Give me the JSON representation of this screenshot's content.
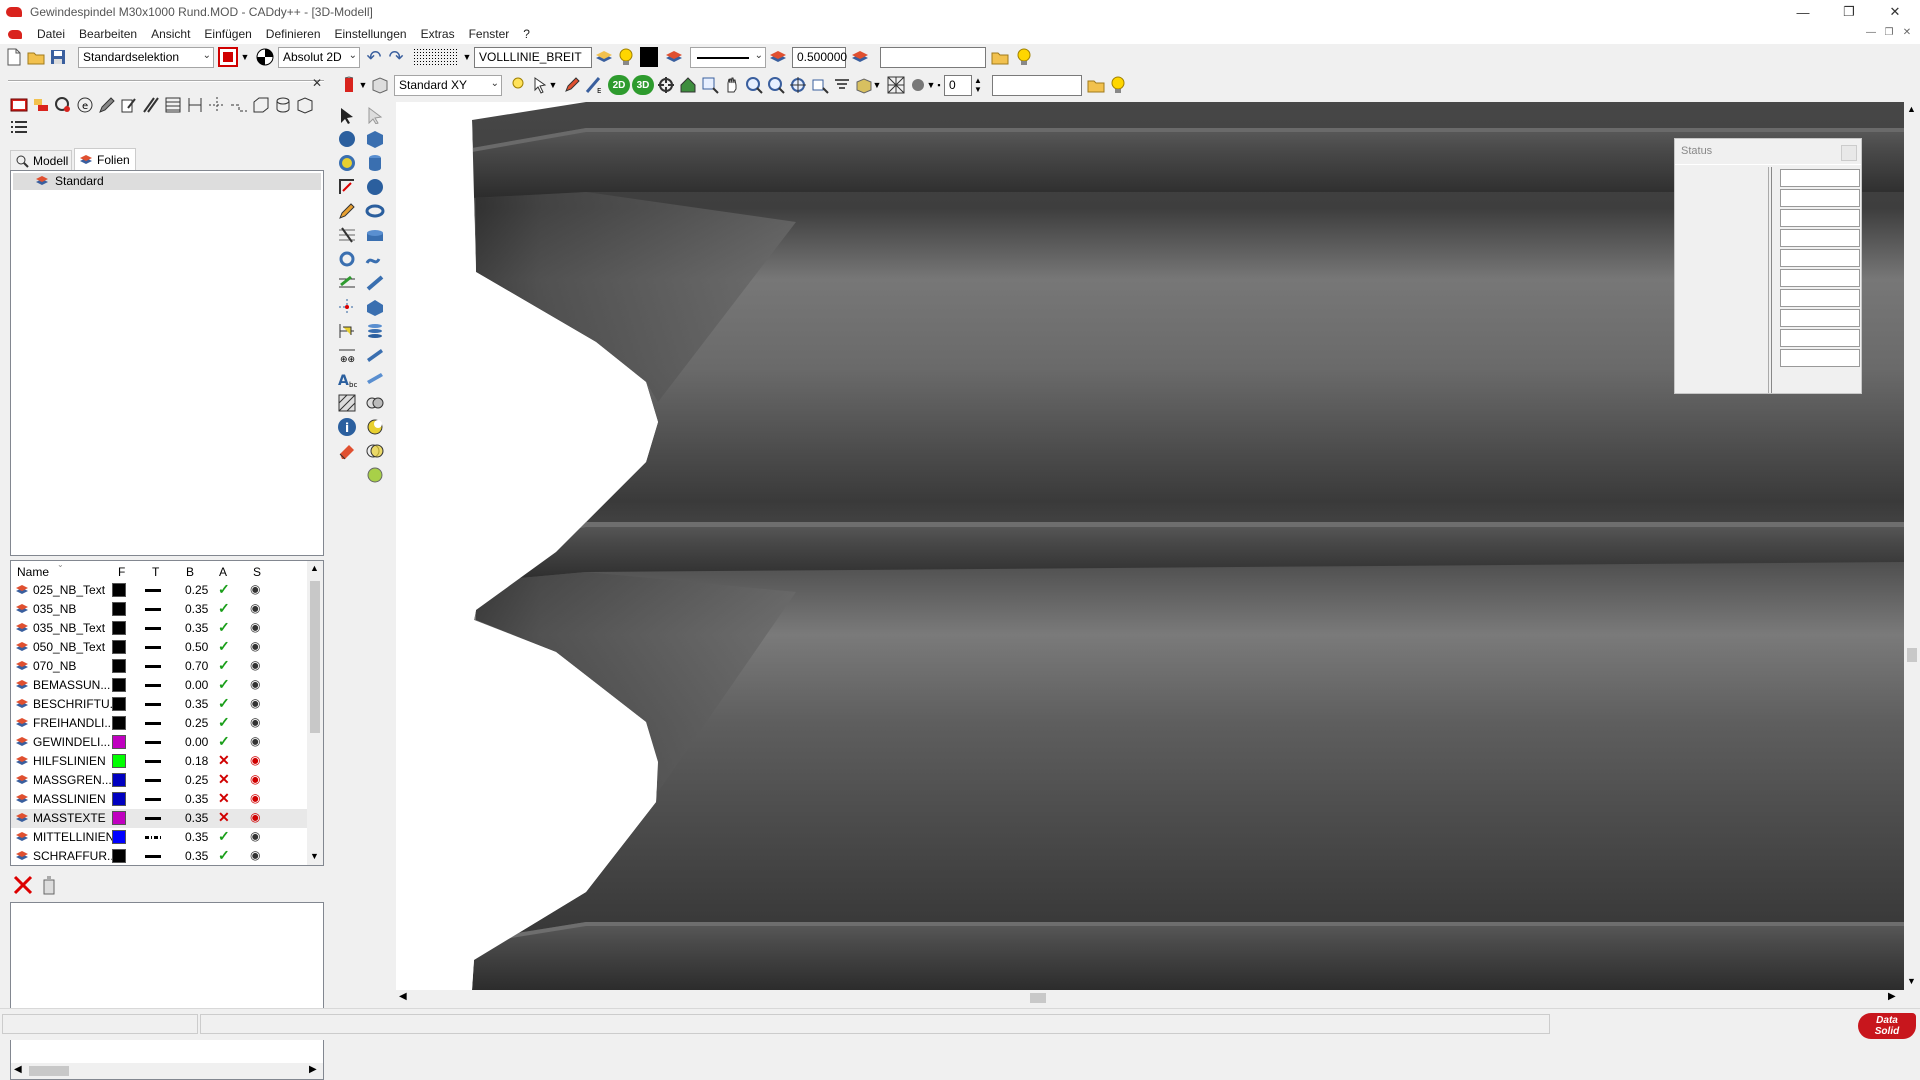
{
  "window": {
    "title": "Gewindespindel M30x1000 Rund.MOD  -  CADdy++ - [3D-Modell]",
    "minimize": "—",
    "maximize": "❐",
    "close": "✕"
  },
  "menu": {
    "items": [
      "Datei",
      "Bearbeiten",
      "Ansicht",
      "Einfügen",
      "Definieren",
      "Einstellungen",
      "Extras",
      "Fenster",
      "?"
    ]
  },
  "toolbar1": {
    "selection_combo": "Standardselektion",
    "coord_combo": "Absolut 2D",
    "linetype_field": "VOLLLINIE_BREIT",
    "linewidth_field": "0.500000",
    "search_field": ""
  },
  "toolbar2": {
    "view_combo": "Standard XY",
    "btn_2d": "2D",
    "btn_3d": "3D",
    "number_field": "0",
    "search_field": ""
  },
  "left_panel": {
    "tabs": [
      {
        "label": "Modell",
        "icon": "model-icon"
      },
      {
        "label": "Folien",
        "icon": "layers-icon"
      }
    ],
    "tree_items": [
      "Standard"
    ],
    "layer_table": {
      "columns": [
        "Name",
        "F",
        "T",
        "B",
        "A",
        "S"
      ],
      "rows": [
        {
          "name": "025_NB_Text",
          "color": "#000000",
          "linetype": "solid",
          "width": "0.25",
          "active": true,
          "visible": true
        },
        {
          "name": "035_NB",
          "color": "#000000",
          "linetype": "solid",
          "width": "0.35",
          "active": true,
          "visible": true
        },
        {
          "name": "035_NB_Text",
          "color": "#000000",
          "linetype": "solid",
          "width": "0.35",
          "active": true,
          "visible": true
        },
        {
          "name": "050_NB_Text",
          "color": "#000000",
          "linetype": "solid",
          "width": "0.50",
          "active": true,
          "visible": true
        },
        {
          "name": "070_NB",
          "color": "#000000",
          "linetype": "solid",
          "width": "0.70",
          "active": true,
          "visible": true
        },
        {
          "name": "BEMASSUN...",
          "color": "#000000",
          "linetype": "solid",
          "width": "0.00",
          "active": true,
          "visible": true
        },
        {
          "name": "BESCHRIFTU...",
          "color": "#000000",
          "linetype": "solid",
          "width": "0.35",
          "active": true,
          "visible": true
        },
        {
          "name": "FREIHANDLI...",
          "color": "#000000",
          "linetype": "solid",
          "width": "0.25",
          "active": true,
          "visible": true
        },
        {
          "name": "GEWINDELI...",
          "color": "#c000c0",
          "linetype": "solid",
          "width": "0.00",
          "active": true,
          "visible": true
        },
        {
          "name": "HILFSLINIEN",
          "color": "#00ff00",
          "linetype": "solid",
          "width": "0.18",
          "active": false,
          "visible": false
        },
        {
          "name": "MASSGREN...",
          "color": "#0000c0",
          "linetype": "solid",
          "width": "0.25",
          "active": false,
          "visible": false
        },
        {
          "name": "MASSLINIEN",
          "color": "#0000c0",
          "linetype": "solid",
          "width": "0.35",
          "active": false,
          "visible": false
        },
        {
          "name": "MASSTEXTE",
          "color": "#c000c0",
          "linetype": "solid",
          "width": "0.35",
          "active": false,
          "visible": false
        },
        {
          "name": "MITTELLINIEN",
          "color": "#0000ff",
          "linetype": "dashdot",
          "width": "0.35",
          "active": true,
          "visible": true
        },
        {
          "name": "SCHRAFFUR...",
          "color": "#000000",
          "linetype": "solid",
          "width": "0.35",
          "active": true,
          "visible": true
        }
      ]
    }
  },
  "status_window": {
    "title": "Status"
  },
  "statusbar": {
    "cell1": "",
    "cell2": "",
    "logo_line1": "Data",
    "logo_line2": "Solid"
  },
  "colors": {
    "accent_red": "#d9231d",
    "thread_dark": "#3c3c3c",
    "thread_light": "#6e6e6e"
  }
}
